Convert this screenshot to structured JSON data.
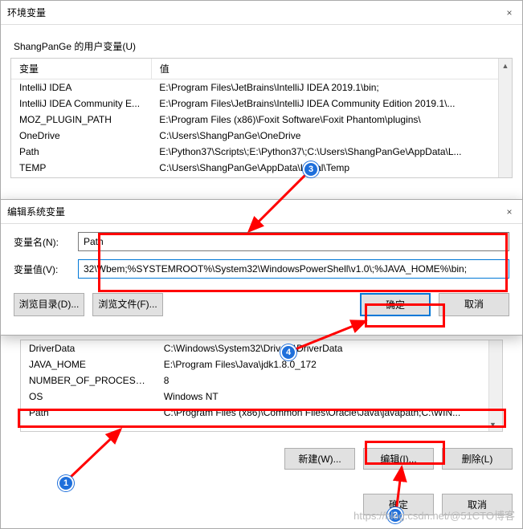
{
  "main_window": {
    "title": "环境变量",
    "close": "×",
    "user_section_label": "ShangPanGe 的用户变量(U)",
    "col_name": "变量",
    "col_value": "值",
    "rows": [
      {
        "name": "IntelliJ IDEA",
        "value": "E:\\Program Files\\JetBrains\\IntelliJ IDEA 2019.1\\bin;"
      },
      {
        "name": "IntelliJ IDEA Community E...",
        "value": "E:\\Program Files\\JetBrains\\IntelliJ IDEA Community Edition 2019.1\\..."
      },
      {
        "name": "MOZ_PLUGIN_PATH",
        "value": "E:\\Program Files (x86)\\Foxit Software\\Foxit Phantom\\plugins\\"
      },
      {
        "name": "OneDrive",
        "value": "C:\\Users\\ShangPanGe\\OneDrive"
      },
      {
        "name": "Path",
        "value": "E:\\Python37\\Scripts\\;E:\\Python37\\;C:\\Users\\ShangPanGe\\AppData\\L..."
      },
      {
        "name": "TEMP",
        "value": "C:\\Users\\ShangPanGe\\AppData\\Local\\Temp"
      }
    ],
    "sys_rows": [
      {
        "name": "DriverData",
        "value": "C:\\Windows\\System32\\Drivers\\DriverData"
      },
      {
        "name": "JAVA_HOME",
        "value": "E:\\Program Files\\Java\\jdk1.8.0_172"
      },
      {
        "name": "NUMBER_OF_PROCESSORS",
        "value": "8"
      },
      {
        "name": "OS",
        "value": "Windows NT"
      },
      {
        "name": "Path",
        "value": "C:\\Program Files (x86)\\Common Files\\Oracle\\Java\\javapath;C:\\WIN..."
      }
    ],
    "btn_new": "新建(W)...",
    "btn_edit": "编辑(I)...",
    "btn_delete": "删除(L)",
    "btn_ok": "确定",
    "btn_cancel": "取消"
  },
  "edit_dialog": {
    "title": "编辑系统变量",
    "close": "×",
    "name_label": "变量名(N):",
    "name_value": "Path",
    "value_label": "变量值(V):",
    "value_value": "32\\Wbem;%SYSTEMROOT%\\System32\\WindowsPowerShell\\v1.0\\;%JAVA_HOME%\\bin;",
    "btn_browse_dir": "浏览目录(D)...",
    "btn_browse_file": "浏览文件(F)...",
    "btn_ok": "确定",
    "btn_cancel": "取消"
  },
  "annotations": {
    "c1": "1",
    "c2": "2",
    "c3": "3",
    "c4": "4"
  },
  "watermark": "https://blog.csdn.net/@51CTO博客"
}
